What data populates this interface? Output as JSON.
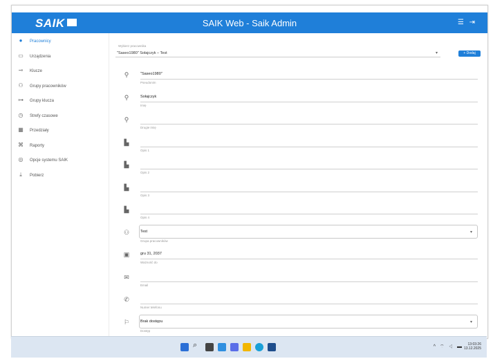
{
  "header": {
    "logo": "SAIK",
    "title": "SAIK Web - Saik Admin",
    "icons": [
      "menu-icon",
      "logout-icon"
    ]
  },
  "sidebar": {
    "items": [
      {
        "label": "Pracownicy",
        "icon": "people-icon",
        "active": true
      },
      {
        "label": "Urządzenia",
        "icon": "device-icon",
        "active": false
      },
      {
        "label": "Klucze",
        "icon": "key-icon",
        "active": false
      },
      {
        "label": "Grupy pracowników",
        "icon": "group-icon",
        "active": false
      },
      {
        "label": "Grupy klucza",
        "icon": "keys-group-icon",
        "active": false
      },
      {
        "label": "Strefy czasowe",
        "icon": "clock-icon",
        "active": false
      },
      {
        "label": "Przedziały",
        "icon": "grid-icon",
        "active": false
      },
      {
        "label": "Raporty",
        "icon": "report-icon",
        "active": false
      },
      {
        "label": "Opcje systemu SAIK",
        "icon": "settings-icon",
        "active": false
      },
      {
        "label": "Pobierz",
        "icon": "download-icon",
        "active": false
      }
    ]
  },
  "main": {
    "user_select": {
      "label": "Wybierz pracownika",
      "value": "\"Saseo1980\" Sołajczyk – Test"
    },
    "add_button": "+ Dodaj",
    "fields": [
      {
        "icon": "person-icon",
        "value": "\"Saseo1980\"",
        "label": "Pseudonim"
      },
      {
        "icon": "person-icon",
        "value": "Sołajczyk",
        "label": "Imię"
      },
      {
        "icon": "person-icon",
        "value": "",
        "label": "Drugie imię"
      },
      {
        "icon": "id-icon",
        "value": "",
        "label": "Opis 1"
      },
      {
        "icon": "id-icon",
        "value": "",
        "label": "Opis 2"
      },
      {
        "icon": "id-icon",
        "value": "",
        "label": "Opis 3"
      },
      {
        "icon": "id-icon",
        "value": "",
        "label": "Opis 4"
      },
      {
        "icon": "group-icon",
        "value": "Test",
        "label": "Grupa pracowników",
        "dropdown": true
      },
      {
        "icon": "calendar-icon",
        "value": "gru 31, 2037",
        "label": "Ważność do"
      },
      {
        "icon": "mail-icon",
        "value": "",
        "label": "Email"
      },
      {
        "icon": "phone-icon",
        "value": "",
        "label": "Numer telefonu"
      },
      {
        "icon": "language-icon",
        "value": "Brak dostępu",
        "label": "Dostęp",
        "dropdown": true
      }
    ]
  },
  "taskbar": {
    "time": "13:03:26",
    "date": "13.12.2025",
    "tray": "^ ⌔ ◁ ▬"
  },
  "colors": {
    "accent": "#1f7fd9"
  }
}
